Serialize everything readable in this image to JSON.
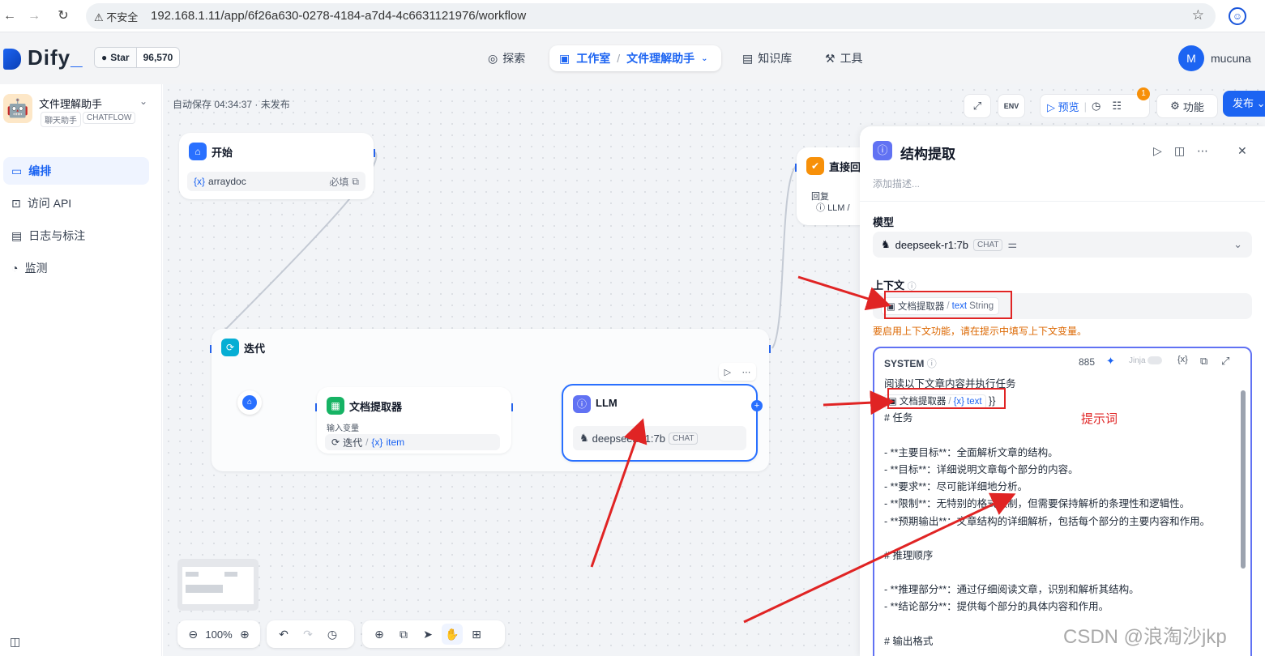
{
  "browser": {
    "security_label": "不安全",
    "url": "192.168.1.11/app/6f26a630-0278-4184-a7d4-4c6631121976/workflow"
  },
  "header": {
    "logo": "Dify",
    "github_label": "Star",
    "github_count": "96,570",
    "nav": {
      "explore": "探索",
      "studio": "工作室",
      "app_crumb": "文件理解助手",
      "knowledge": "知识库",
      "tools": "工具"
    },
    "user_initial": "M",
    "user_name": "mucuna"
  },
  "sidebar": {
    "app_name": "文件理解助手",
    "tags": [
      "聊天助手",
      "CHATFLOW"
    ],
    "items": [
      {
        "label": "编排",
        "icon": "layout-icon",
        "active": true
      },
      {
        "label": "访问 API",
        "icon": "terminal-icon",
        "active": false
      },
      {
        "label": "日志与标注",
        "icon": "document-icon",
        "active": false
      },
      {
        "label": "监测",
        "icon": "gauge-icon",
        "active": false
      }
    ]
  },
  "canvas": {
    "autosave": "自动保存 04:34:37 · 未发布",
    "toolbar": {
      "preview": "预览",
      "features": "功能",
      "publish": "发布",
      "env": "ENV",
      "badge": "1"
    },
    "nodes": {
      "start": {
        "title": "开始",
        "var_name": "arraydoc",
        "required": "必填"
      },
      "answer": {
        "title": "直接回",
        "reply_label": "回复",
        "source": "LLM /"
      },
      "iteration": {
        "title": "迭代"
      },
      "doc_extractor": {
        "title": "文档提取器",
        "input_label": "输入变量",
        "iter_label": "迭代",
        "item_var": "item"
      },
      "llm": {
        "title": "LLM",
        "model": "deepseek-r1:7b",
        "mode": "CHAT"
      }
    },
    "zoom": "100%"
  },
  "panel": {
    "title": "结构提取",
    "description_placeholder": "添加描述...",
    "model_label": "模型",
    "model_name": "deepseek-r1:7b",
    "model_mode": "CHAT",
    "context_label": "上下文",
    "context_source": "文档提取器",
    "context_var": "text",
    "context_type": "String",
    "context_warning": "要启用上下文功能，请在提示中填写上下文变量。",
    "prompt": {
      "role": "SYSTEM",
      "count": "885",
      "jinja": "Jinja",
      "var_source": "文档提取器",
      "var_name": "text",
      "line_intro": "阅读以下文章内容并执行任务",
      "lines": [
        "# 任务",
        "",
        "- **主要目标**：全面解析文章的结构。",
        "- **目标**：详细说明文章每个部分的内容。",
        "- **要求**：尽可能详细地分析。",
        "- **限制**：无特别的格式限制，但需要保持解析的条理性和逻辑性。",
        "- **预期输出**：文章结构的详细解析，包括每个部分的主要内容和作用。",
        "",
        "# 推理顺序",
        "",
        "- **推理部分**：通过仔细阅读文章，识别和解析其结构。",
        "- **结论部分**：提供每个部分的具体内容和作用。",
        "",
        "# 输出格式"
      ]
    }
  },
  "annotations": {
    "label": "提示词",
    "color": "#e02424"
  },
  "watermark": "CSDN @浪淘沙jkp"
}
